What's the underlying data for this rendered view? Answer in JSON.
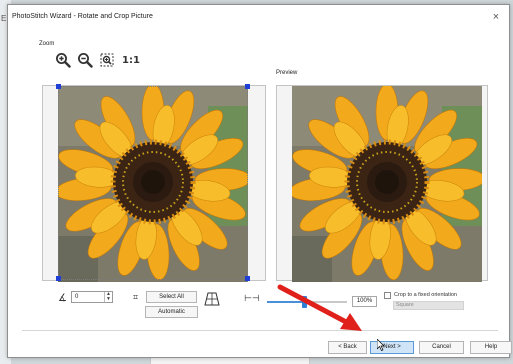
{
  "window": {
    "title": "PhotoStitch Wizard - Rotate and Crop Picture",
    "close_glyph": "×"
  },
  "background": {
    "left_glyph": "E"
  },
  "zoom": {
    "label": "Zoom",
    "buttons": [
      {
        "name": "zoom-in-icon"
      },
      {
        "name": "zoom-out-icon"
      },
      {
        "name": "zoom-fit-icon"
      },
      {
        "name": "actual-size",
        "label": "1:1"
      }
    ]
  },
  "preview": {
    "label": "Preview"
  },
  "controls": {
    "angle_icon": "angle-icon",
    "angle_value": "0",
    "crop_icon": "crop-icon",
    "select_all_label": "Select All",
    "automatic_label": "Automatic",
    "perspective_icon": "perspective-icon",
    "fit_icon": "fit-width-icon",
    "zoom_percent": "100%",
    "zoom_slider_fraction": 0.47,
    "crop_fixed_label": "Crop to a fixed orientation",
    "crop_fixed_checked": false,
    "orientation_value": "Square"
  },
  "footer": {
    "back_label": "< Back",
    "next_label": "Next >",
    "cancel_label": "Cancel",
    "help_label": "Help"
  },
  "colors": {
    "accent": "#2f7fd6",
    "handle": "#1f3fd6",
    "annotation_arrow": "#e0201b",
    "next_button_bg": "#cfe4f7"
  }
}
